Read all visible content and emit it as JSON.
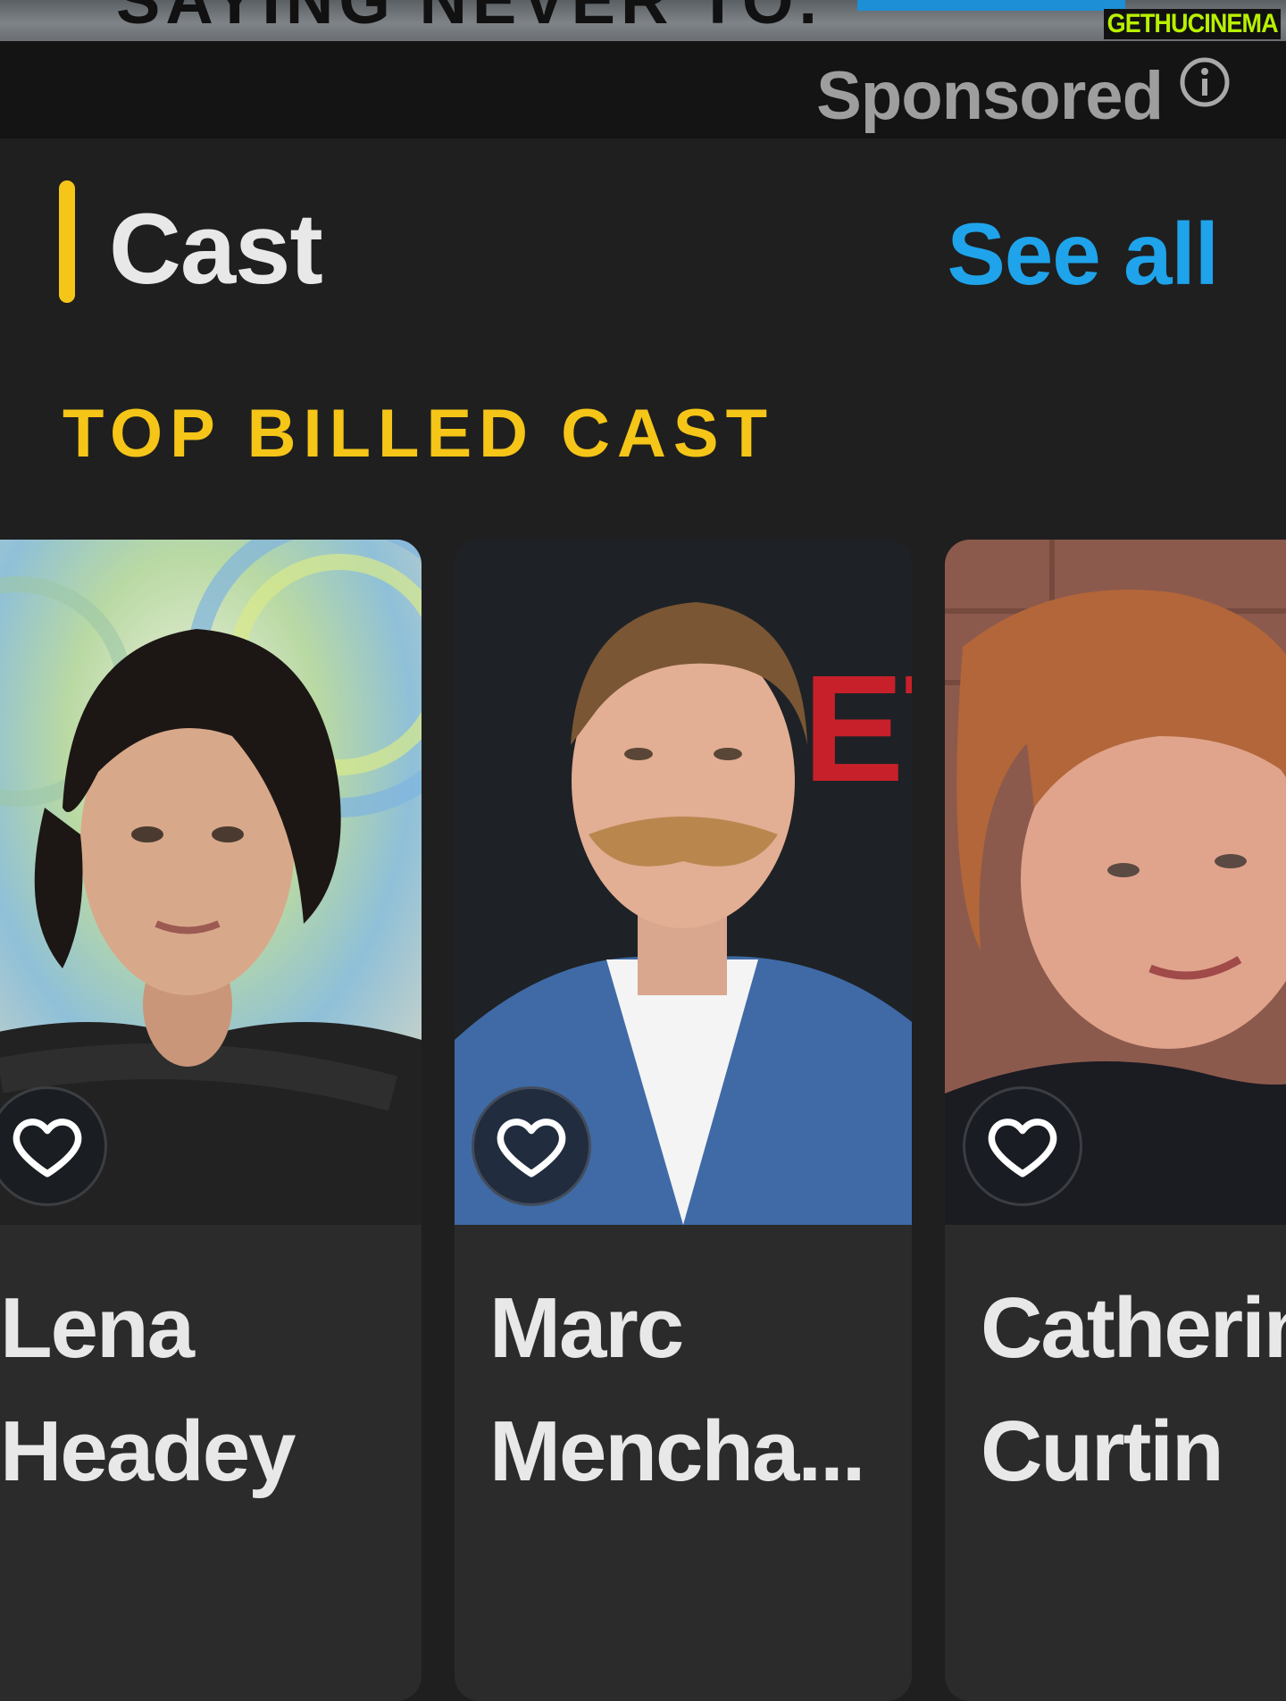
{
  "ad": {
    "partial_text": "SAYING NEVER TO.",
    "watermark_part1": "GETHU",
    "watermark_part2": "CINEMA"
  },
  "sponsored": {
    "label": "Sponsored",
    "info_icon": "info-icon"
  },
  "section": {
    "title": "Cast",
    "see_all": "See all",
    "subheading": "TOP BILLED CAST"
  },
  "cast": [
    {
      "first": "Lena",
      "last": "Headey",
      "favorite_icon": "heart-outline-icon"
    },
    {
      "first": "Marc",
      "last": "Mencha...",
      "favorite_icon": "heart-outline-icon"
    },
    {
      "first": "Catherin",
      "last": "Curtin",
      "favorite_icon": "heart-outline-icon"
    }
  ],
  "colors": {
    "background": "#1f1f1f",
    "accent_yellow": "#f5c518",
    "link_blue": "#1fa3ea",
    "card": "#2b2b2b"
  }
}
